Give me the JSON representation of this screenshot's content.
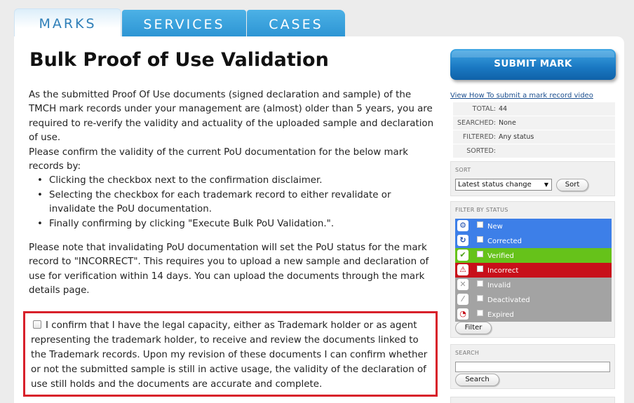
{
  "tabs": [
    {
      "label": "MARKS",
      "active": true
    },
    {
      "label": "SERVICES",
      "active": false
    },
    {
      "label": "CASES",
      "active": false
    }
  ],
  "page_title": "Bulk Proof of Use Validation",
  "intro": {
    "paragraph1": "As the submitted Proof Of Use documents (signed declaration and sample) of the TMCH mark records under your management are (almost) older than 5 years, you are required to re-verify the validity and actuality of the uploaded sample and declaration of use.",
    "paragraph2": "Please confirm the validity of the current PoU documentation for the below mark records by:",
    "steps": [
      "Clicking the checkbox next to the confirmation disclaimer.",
      "Selecting the checkbox for each trademark record to either revalidate or invalidate the PoU documentation.",
      "Finally confirming by clicking \"Execute Bulk PoU Validation.\"."
    ],
    "paragraph3": "Please note that invalidating PoU documentation will set the PoU status for the mark record to \"INCORRECT\". This requires you to upload a new sample and declaration of use for verification within 14 days. You can upload the documents through the mark details page."
  },
  "confirmation": {
    "text": "I confirm that I have the legal capacity, either as Trademark holder or as agent representing the trademark holder, to receive and review the documents linked to the Trademark records. Upon my revision of these documents I can confirm whether or not the submitted sample is still in active usage, the validity of the declaration of use still holds and the documents are accurate and complete.",
    "checked": false
  },
  "sidebar": {
    "submit_label": "SUBMIT MARK",
    "video_link": "View How To submit a mark record video",
    "stats": [
      {
        "label": "TOTAL:",
        "value": "44"
      },
      {
        "label": "SEARCHED:",
        "value": "None"
      },
      {
        "label": "FILTERED:",
        "value": "Any status"
      },
      {
        "label": "SORTED:",
        "value": ""
      }
    ],
    "sort": {
      "label": "SORT",
      "selected": "Latest status change",
      "button": "Sort"
    },
    "filter": {
      "label": "FILTER BY STATUS",
      "statuses": [
        {
          "label": "New",
          "color": "#3d7fe8",
          "icon": "gear-icon",
          "glyph": "⚙",
          "icon_color": "#1f4fb0"
        },
        {
          "label": "Corrected",
          "color": "#3d7fe8",
          "icon": "refresh-icon",
          "glyph": "↻",
          "icon_color": "#1f4fb0"
        },
        {
          "label": "Verified",
          "color": "#66c21a",
          "icon": "checkmark-icon",
          "glyph": "✔",
          "icon_color": "#4a9e0e"
        },
        {
          "label": "Incorrect",
          "color": "#c8101a",
          "icon": "warning-icon",
          "glyph": "⚠",
          "icon_color": "#c8101a"
        },
        {
          "label": "Invalid",
          "color": "#a3a3a3",
          "icon": "x-icon",
          "glyph": "✕",
          "icon_color": "#9a9a9a"
        },
        {
          "label": "Deactivated",
          "color": "#a3a3a3",
          "icon": "slash-icon",
          "glyph": "⁄",
          "icon_color": "#9a9a9a"
        },
        {
          "label": "Expired",
          "color": "#a3a3a3",
          "icon": "clock-icon",
          "glyph": "◔",
          "icon_color": "#c8101a"
        }
      ],
      "button": "Filter"
    },
    "search": {
      "label": "SEARCH",
      "value": "",
      "button": "Search"
    }
  }
}
